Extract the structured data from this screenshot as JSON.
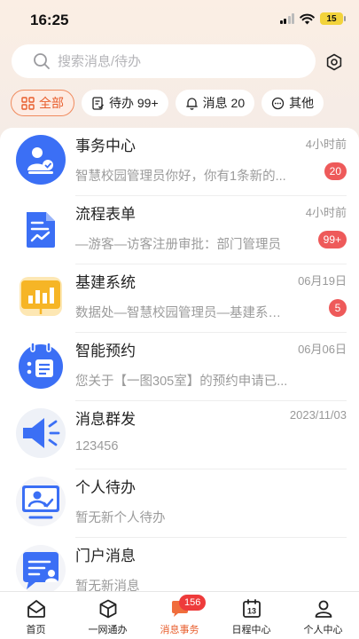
{
  "status_bar": {
    "time": "16:25",
    "battery": "15"
  },
  "search": {
    "placeholder": "搜索消息/待办"
  },
  "tabs": [
    {
      "label": "全部",
      "icon": "grid-icon",
      "active": true
    },
    {
      "label": "待办 99+",
      "icon": "todo-icon"
    },
    {
      "label": "消息 20",
      "icon": "bell-icon"
    },
    {
      "label": "其他",
      "icon": "more-circle-icon"
    }
  ],
  "list": [
    {
      "title": "事务中心",
      "time": "4小时前",
      "subtitle": "智慧校园管理员你好，你有1条新的...",
      "badge": "20",
      "icon": "affairs-center-icon"
    },
    {
      "title": "流程表单",
      "time": "4小时前",
      "subtitle": "—游客—访客注册审批：部门管理员",
      "badge": "99+",
      "icon": "process-form-icon"
    },
    {
      "title": "基建系统",
      "time": "06月19日",
      "subtitle": "数据处—智慧校园管理员—基建系统...",
      "badge": "5",
      "icon": "infrastructure-icon"
    },
    {
      "title": "智能预约",
      "time": "06月06日",
      "subtitle": "您关于【一图305室】的预约申请已...",
      "badge": "",
      "icon": "calendar-reservation-icon"
    },
    {
      "title": "消息群发",
      "time": "2023/11/03",
      "subtitle": "123456",
      "badge": "",
      "icon": "megaphone-icon"
    },
    {
      "title": "个人待办",
      "time": "",
      "subtitle": "暂无新个人待办",
      "badge": "",
      "icon": "personal-todo-icon"
    },
    {
      "title": "门户消息",
      "time": "",
      "subtitle": "暂无新消息",
      "badge": "",
      "icon": "portal-message-icon"
    }
  ],
  "bottom_nav": [
    {
      "label": "首页",
      "icon": "home-icon"
    },
    {
      "label": "一网通办",
      "icon": "cube-icon"
    },
    {
      "label": "消息事务",
      "icon": "message-icon",
      "badge": "156",
      "active": true
    },
    {
      "label": "日程中心",
      "icon": "calendar-13-icon",
      "day": "13"
    },
    {
      "label": "个人中心",
      "icon": "user-icon"
    }
  ],
  "colors": {
    "accent": "#e85d2c",
    "badge": "#ee5a5a",
    "icon_blue": "#3b6ff5",
    "icon_yellow": "#f6b526"
  }
}
